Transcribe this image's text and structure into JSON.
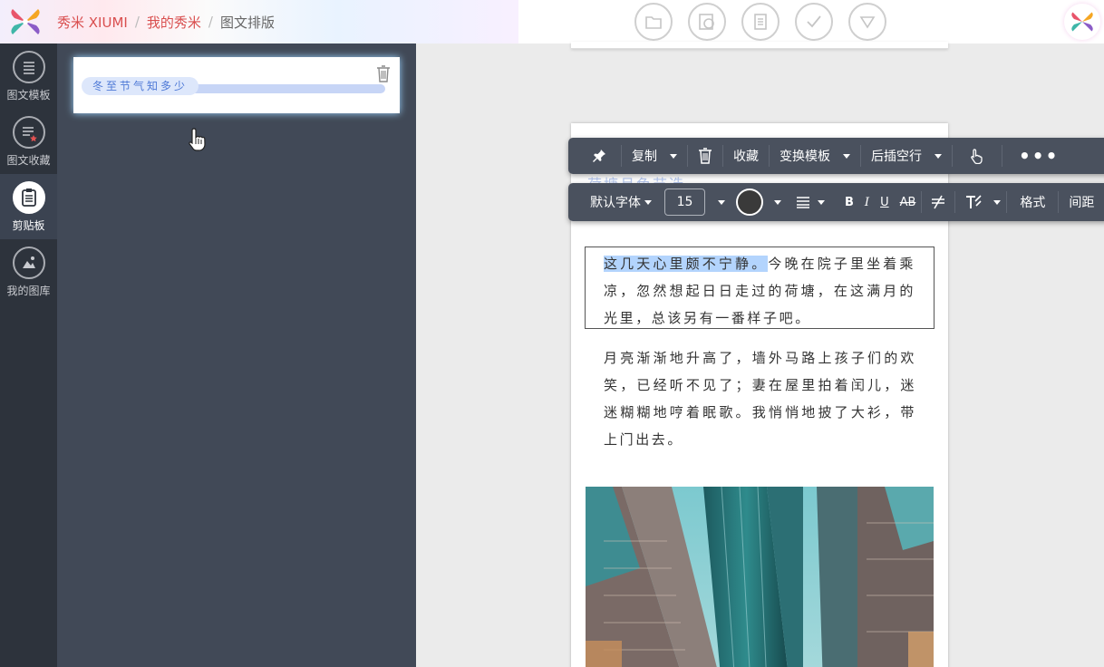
{
  "app": {
    "brand": "秀米 XIUMI"
  },
  "breadcrumb": {
    "home": "秀米 XIUMI",
    "section": "我的秀米",
    "current": "图文排版",
    "separator": "/"
  },
  "top_tools": [
    {
      "icon": "folder-icon"
    },
    {
      "icon": "preview-icon"
    },
    {
      "icon": "save-icon"
    },
    {
      "icon": "check-icon"
    },
    {
      "icon": "dropdown-icon"
    }
  ],
  "sidebar": {
    "items": [
      {
        "label": "图文模板",
        "icon": "list-icon",
        "active": false
      },
      {
        "label": "图文收藏",
        "icon": "favorite-list-icon",
        "active": false
      },
      {
        "label": "剪贴板",
        "icon": "clipboard-icon",
        "active": true
      },
      {
        "label": "我的图库",
        "icon": "image-library-icon",
        "active": false
      }
    ]
  },
  "clipboard": {
    "card_title": "冬至节气知多少"
  },
  "toolbar_top": {
    "copy": "复制",
    "collect": "收藏",
    "change_template": "变换模板",
    "insert_after": "后插空行",
    "more": "•••"
  },
  "toolbar_format": {
    "font": "默认字体",
    "size": "15",
    "bold": "B",
    "italic": "I",
    "underline": "U",
    "strike": "AB",
    "format": "格式",
    "spacing": "间距"
  },
  "article": {
    "ghost_title": "荷塘月色节选",
    "para1_selected": "这几天心里颇不宁静。",
    "para1_rest": "今晚在院子里坐着乘凉，忽然想起日日走过的荷塘，在这满月的光里，总该另有一番样子吧。",
    "para2": "月亮渐渐地升高了，墙外马路上孩子们的欢笑，已经听不见了；妻在屋里拍着闰儿，迷迷糊糊地哼着眠歌。我悄悄地披了大衫，带上门出去。"
  },
  "colors": {
    "brand_red": "#d94f4f",
    "sidebar_bg": "#2d333c",
    "panel_bg": "#414957",
    "toolbar_bg": "#4a515e",
    "highlight": "#b3d4fd"
  }
}
